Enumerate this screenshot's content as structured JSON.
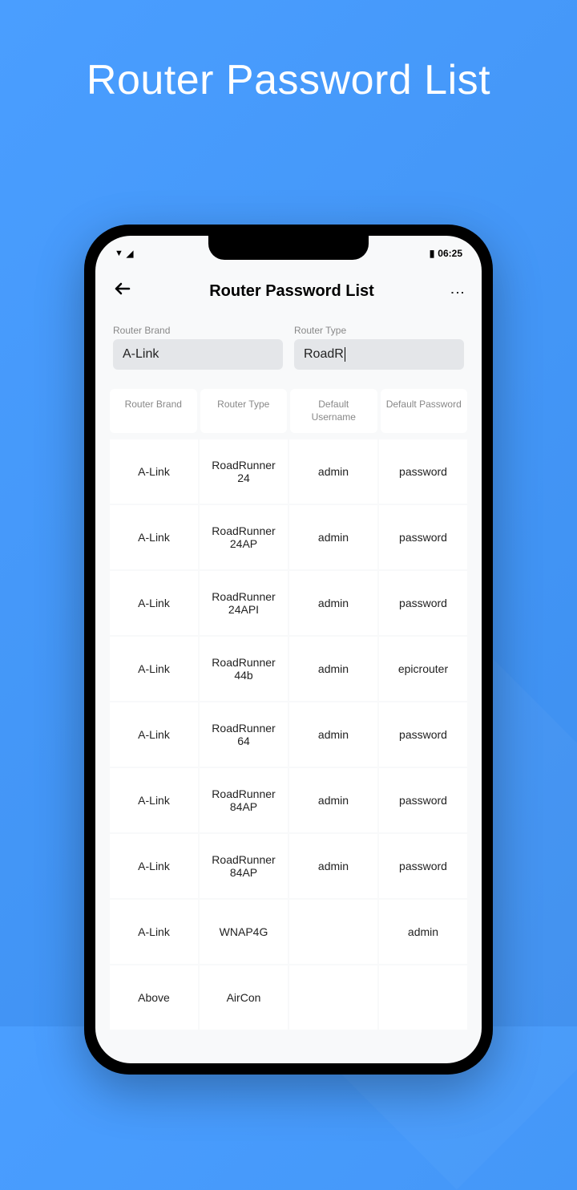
{
  "promo": {
    "title": "Router Password List"
  },
  "status_bar": {
    "time": "06:25"
  },
  "app": {
    "title": "Router Password List"
  },
  "filters": {
    "brand_label": "Router Brand",
    "brand_value": "A-Link",
    "type_label": "Router Type",
    "type_value": "RoadR"
  },
  "table": {
    "headers": [
      "Router Brand",
      "Router Type",
      "Default Username",
      "Default Password"
    ],
    "rows": [
      {
        "brand": "A-Link",
        "type": "RoadRunner 24",
        "username": "admin",
        "password": "password"
      },
      {
        "brand": "A-Link",
        "type": "RoadRunner 24AP",
        "username": "admin",
        "password": "password"
      },
      {
        "brand": "A-Link",
        "type": "RoadRunner 24API",
        "username": "admin",
        "password": "password"
      },
      {
        "brand": "A-Link",
        "type": "RoadRunner 44b",
        "username": "admin",
        "password": "epicrouter"
      },
      {
        "brand": "A-Link",
        "type": "RoadRunner 64",
        "username": "admin",
        "password": "password"
      },
      {
        "brand": "A-Link",
        "type": "RoadRunner 84AP",
        "username": "admin",
        "password": "password"
      },
      {
        "brand": "A-Link",
        "type": "RoadRunner 84AP",
        "username": "admin",
        "password": "password"
      },
      {
        "brand": "A-Link",
        "type": "WNAP4G",
        "username": "",
        "password": "admin"
      },
      {
        "brand": "Above",
        "type": "AirCon",
        "username": "",
        "password": ""
      }
    ]
  }
}
